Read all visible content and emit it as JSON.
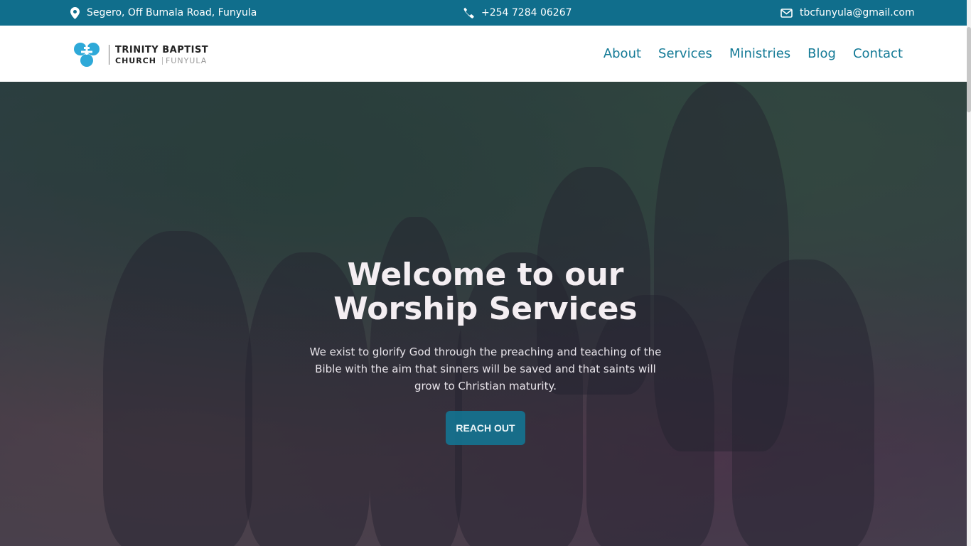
{
  "topbar": {
    "address": "Segero, Off Bumala Road, Funyula",
    "phone": "+254 7284 06267",
    "email": "tbcfunyula@gmail.com"
  },
  "logo": {
    "line1": "TRINITY BAPTIST",
    "line2a": "CHURCH",
    "line2b": "FUNYULA"
  },
  "menu": [
    "About",
    "Services",
    "Ministries",
    "Blog",
    "Contact"
  ],
  "hero": {
    "title_line1": "Welcome to our",
    "title_line2": "Worship Services",
    "text": "We exist to glorify God through the preaching and teaching of the Bible with the aim that sinners will be saved and that saints will grow to Christian maturity.",
    "button": "REACH OUT"
  },
  "colors": {
    "topbar": "#106e8c",
    "accent": "#137a96",
    "logo_blue": "#2ea9d8"
  }
}
